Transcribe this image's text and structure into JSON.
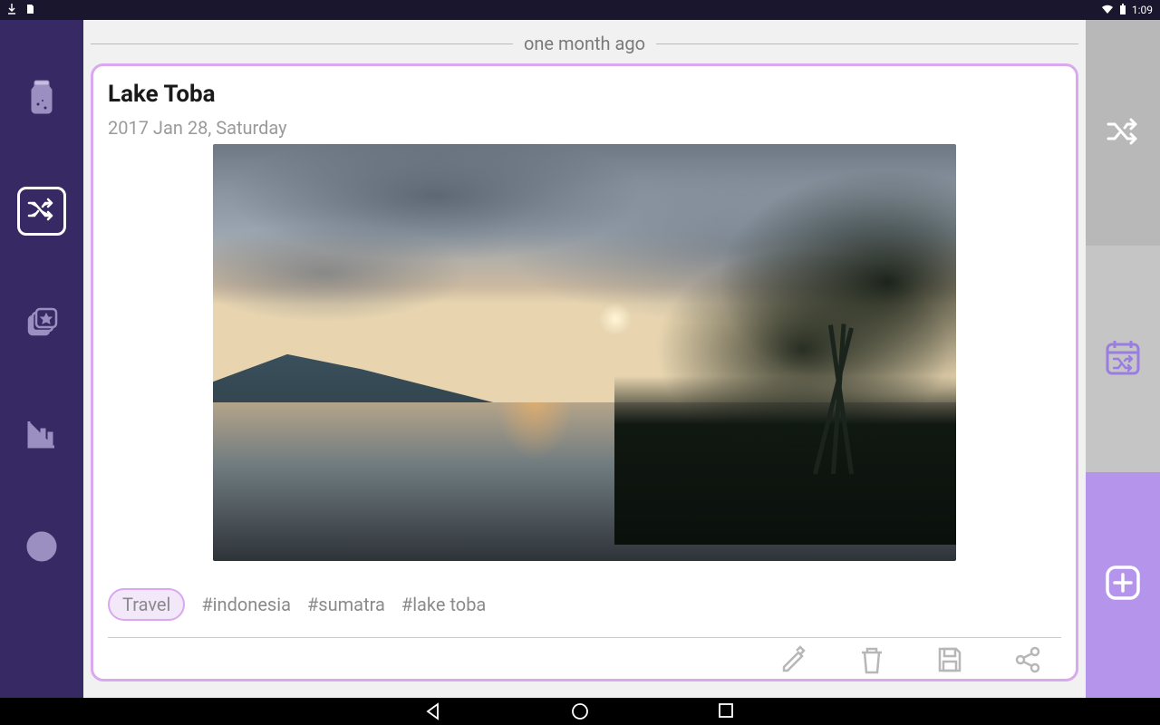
{
  "statusbar": {
    "time": "1:09"
  },
  "header": {
    "time_label": "one month ago"
  },
  "entry": {
    "title": "Lake Toba",
    "date": "2017 Jan 28, Saturday",
    "category_chip": "Travel",
    "tags": [
      "#indonesia",
      "#sumatra",
      "#lake toba"
    ]
  },
  "colors": {
    "sidebar_bg": "#372964",
    "card_border": "#d9a8ee",
    "accent": "#b595ec"
  },
  "icons": {
    "left": [
      "jar-icon",
      "shuffle-icon",
      "cards-icon",
      "bar-chart-icon",
      "help-icon"
    ],
    "right": [
      "shuffle-icon",
      "calendar-shuffle-icon",
      "add-icon"
    ],
    "actions": [
      "edit-icon",
      "delete-icon",
      "save-icon",
      "share-icon"
    ]
  }
}
